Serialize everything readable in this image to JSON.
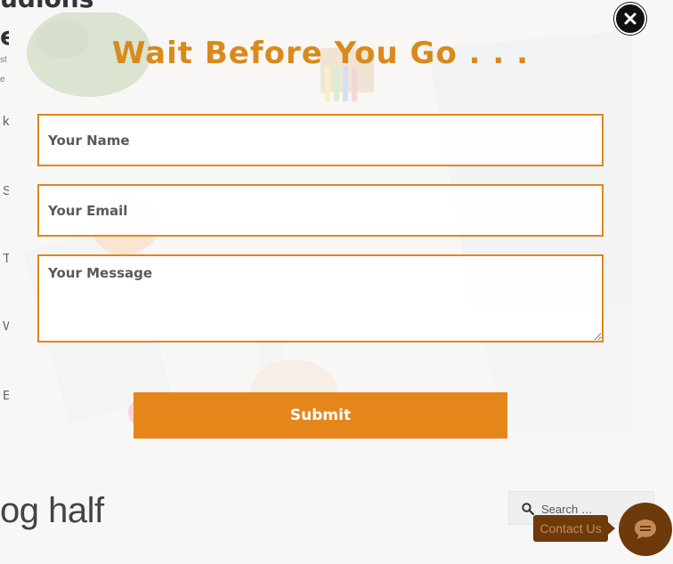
{
  "background": {
    "heading_line1": "udions",
    "heading_line2": "e",
    "small_1": "st",
    "small_2": "e",
    "side_letters": [
      "k",
      "S",
      "T",
      "W",
      "E"
    ],
    "bottom_title": "og half",
    "search": {
      "placeholder": "Search …",
      "icon": "search-icon"
    },
    "contact": {
      "label": "Contact Us",
      "icon": "chat-icon"
    }
  },
  "modal": {
    "title": "Wait Before You Go . . .",
    "fields": {
      "name_placeholder": "Your Name",
      "email_placeholder": "Your Email",
      "message_placeholder": "Your Message"
    },
    "submit_label": "Submit",
    "close_icon": "close-icon"
  },
  "colors": {
    "accent": "#e5861a",
    "title": "#d88a1c",
    "contact_bg": "#6e3a0c"
  }
}
